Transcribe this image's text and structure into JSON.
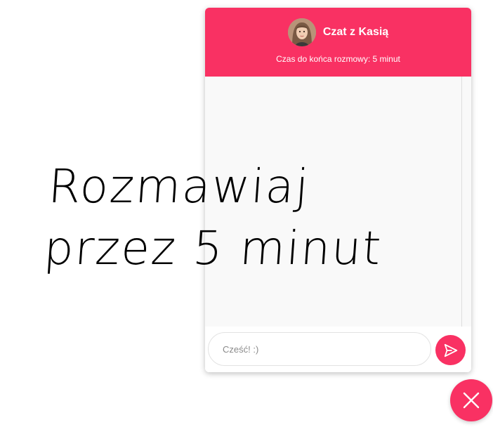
{
  "chat": {
    "title": "Czat z Kasią",
    "subtitle": "Czas do końca rozmowy: 5 minut",
    "input_placeholder": "Cześć! :)",
    "input_value": ""
  },
  "promo": {
    "line1": "Rozmawiaj",
    "line2": "przez 5 minut"
  },
  "icons": {
    "send": "send-icon",
    "close": "close-icon",
    "avatar": "avatar"
  },
  "colors": {
    "accent": "#f93163",
    "messages_bg": "#f9f9f9"
  }
}
